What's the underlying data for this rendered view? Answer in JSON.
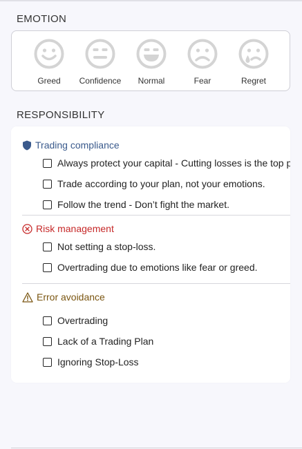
{
  "emotion": {
    "title": "EMOTION",
    "items": [
      {
        "label": "Greed",
        "icon": "smile-face-icon"
      },
      {
        "label": "Confidence",
        "icon": "neutral-face-icon"
      },
      {
        "label": "Normal",
        "icon": "grin-face-icon"
      },
      {
        "label": "Fear",
        "icon": "frown-face-icon"
      },
      {
        "label": "Regret",
        "icon": "sad-tear-face-icon"
      }
    ]
  },
  "responsibility": {
    "title": "RESPONSIBILITY",
    "groups": [
      {
        "title": "Trading compliance",
        "icon": "shield-icon",
        "color": "#3a5a8c",
        "items": [
          "Always protect your capital - Cutting losses is the top priority.",
          "Trade according to your plan, not your emotions.",
          "Follow the trend - Don’t fight the market."
        ]
      },
      {
        "title": "Risk management",
        "icon": "x-circle-icon",
        "color": "#c62828",
        "items": [
          "Not setting a stop-loss.",
          "Overtrading due to emotions like fear or greed."
        ]
      },
      {
        "title": "Error avoidance",
        "icon": "warning-triangle-icon",
        "color": "#7a5510",
        "items": [
          "Overtrading",
          "Lack of a Trading Plan",
          "Ignoring Stop-Loss"
        ]
      }
    ]
  }
}
